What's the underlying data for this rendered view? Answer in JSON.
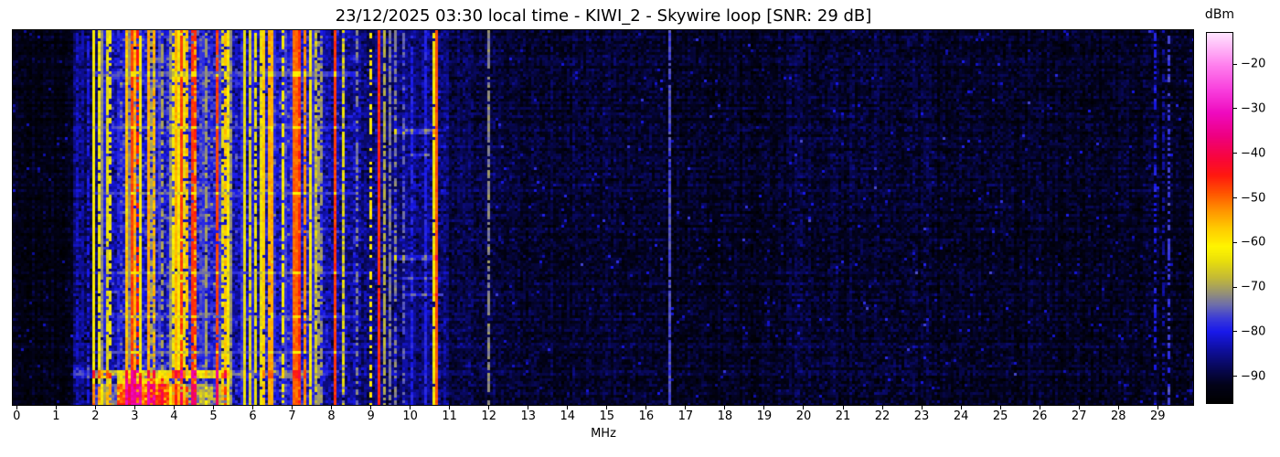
{
  "title": "23/12/2025 03:30 local time - KIWI_2 - Skywire loop [SNR: 29 dB]",
  "chart_data": {
    "type": "heatmap",
    "subtype": "radio-spectrogram-waterfall",
    "xlabel": "MHz",
    "x_range": [
      -0.1,
      29.9
    ],
    "x_ticks": [
      0,
      1,
      2,
      3,
      4,
      5,
      6,
      7,
      8,
      9,
      10,
      11,
      12,
      13,
      14,
      15,
      16,
      17,
      18,
      19,
      20,
      21,
      22,
      23,
      24,
      25,
      26,
      27,
      28,
      29
    ],
    "y_axis": {
      "label": "",
      "ticks": [],
      "meaning": "time, no labels shown"
    },
    "grid": false,
    "legend": false,
    "colorbar": {
      "label": "dBm",
      "ticks": [
        -20,
        -30,
        -40,
        -50,
        -60,
        -70,
        -80,
        -90
      ],
      "range": [
        -96,
        -13
      ],
      "position": "right"
    },
    "colormap_stops": [
      [
        -96,
        "#000000"
      ],
      [
        -92,
        "#020219"
      ],
      [
        -88,
        "#08085a"
      ],
      [
        -84,
        "#0f0fa0"
      ],
      [
        -80,
        "#1919eb"
      ],
      [
        -77,
        "#3c3cd7"
      ],
      [
        -74,
        "#6e6eaa"
      ],
      [
        -71,
        "#9b966e"
      ],
      [
        -68,
        "#c3b937"
      ],
      [
        -64,
        "#ebe10a"
      ],
      [
        -61,
        "#fff500"
      ],
      [
        -57,
        "#ffcd00"
      ],
      [
        -53,
        "#ff9600"
      ],
      [
        -49,
        "#ff5500"
      ],
      [
        -45,
        "#ff190f"
      ],
      [
        -41,
        "#f8053c"
      ],
      [
        -36,
        "#ee0082"
      ],
      [
        -31,
        "#ee0abe"
      ],
      [
        -26,
        "#f83cdc"
      ],
      [
        -20,
        "#ff82ee"
      ],
      [
        -13,
        "#ffe4ff"
      ]
    ],
    "signals": {
      "units": "MHz / dBm",
      "noise_regions": [
        [
          -0.1,
          1.45,
          -92.5,
          2.8
        ],
        [
          1.45,
          2.05,
          -87,
          4.5
        ],
        [
          2.05,
          2.6,
          -84,
          6
        ],
        [
          2.6,
          5.45,
          -80,
          7
        ],
        [
          5.45,
          6.2,
          -83,
          6
        ],
        [
          6.2,
          7.55,
          -81,
          6.5
        ],
        [
          7.55,
          8.75,
          -84,
          5.5
        ],
        [
          8.75,
          9.5,
          -86,
          5
        ],
        [
          9.5,
          10.95,
          -85.5,
          4.5
        ],
        [
          10.95,
          12.15,
          -89,
          4
        ],
        [
          12.15,
          16.5,
          -90.5,
          3.5
        ],
        [
          16.5,
          19.5,
          -91.5,
          3.5
        ],
        [
          19.5,
          23.3,
          -90.5,
          3.8
        ],
        [
          23.3,
          30,
          -91.5,
          3.5
        ]
      ],
      "carriers": [
        {
          "f": 1.55,
          "w": 0.03,
          "level": -82,
          "duty": 0.7
        },
        {
          "f": 1.7,
          "w": 0.03,
          "level": -84,
          "duty": 0.6
        },
        {
          "f": 1.84,
          "w": 0.03,
          "level": -80,
          "duty": 0.65
        },
        {
          "f": 1.97,
          "w": 0.05,
          "level": -61,
          "duty": 1
        },
        {
          "f": 3.08,
          "w": 0.1,
          "level": -45,
          "duty": 0.5
        },
        {
          "f": 6.29,
          "w": 0.07,
          "level": -57,
          "duty": 0.95
        },
        {
          "f": 7.08,
          "w": 0.2,
          "level": -50,
          "duty": 1
        },
        {
          "f": 7.18,
          "w": 0.09,
          "level": -46,
          "duty": 0.85
        },
        {
          "f": 7.3,
          "w": 0.06,
          "level": -52,
          "duty": 0.9
        },
        {
          "f": 8.06,
          "w": 0.04,
          "level": -47,
          "duty": 1
        },
        {
          "f": 8.95,
          "w": 0.05,
          "level": -60,
          "duty": 0.45
        },
        {
          "f": 9.21,
          "w": 0.05,
          "level": -46,
          "duty": 0.95
        },
        {
          "f": 9.33,
          "w": 0.04,
          "level": -69,
          "duty": 0.8
        },
        {
          "f": 9.45,
          "w": 0.03,
          "level": -73,
          "duty": 0.85
        },
        {
          "f": 10.62,
          "w": 0.14,
          "level": -63,
          "duty": 0.9
        },
        {
          "f": 10.66,
          "w": 0.06,
          "level": -49,
          "duty": 1
        },
        {
          "f": 11.96,
          "w": 0.03,
          "level": -72,
          "duty": 0.85
        },
        {
          "f": 16.55,
          "w": 0.03,
          "level": -76,
          "duty": 0.9
        },
        {
          "f": 28.92,
          "w": 0.045,
          "level": -80,
          "duty": 0.5
        },
        {
          "f": 29.1,
          "w": 0.03,
          "level": -84,
          "duty": 0.4
        },
        {
          "f": 29.27,
          "w": 0.05,
          "level": -77,
          "duty": 0.55
        }
      ],
      "stripe_fields": [
        {
          "f0": 2.05,
          "f1": 2.6,
          "count": 7,
          "wmin": 0.025,
          "wmax": 0.05,
          "levels": [
            -79,
            -73,
            -64
          ],
          "weights": [
            0.6,
            0.2,
            0.2
          ],
          "dmin": 0.6,
          "dmax": 1
        },
        {
          "f0": 2.6,
          "f1": 5.45,
          "count": 48,
          "wmin": 0.02,
          "wmax": 0.06,
          "levels": [
            -78,
            -71,
            -63,
            -55,
            -47
          ],
          "weights": [
            0.28,
            0.14,
            0.33,
            0.15,
            0.1
          ],
          "dmin": 0.55,
          "dmax": 1
        },
        {
          "f0": 5.45,
          "f1": 6.2,
          "count": 9,
          "wmin": 0.02,
          "wmax": 0.045,
          "levels": [
            -78,
            -64
          ],
          "weights": [
            0.5,
            0.5
          ],
          "dmin": 0.6,
          "dmax": 1
        },
        {
          "f0": 6.2,
          "f1": 7.55,
          "count": 16,
          "wmin": 0.02,
          "wmax": 0.05,
          "levels": [
            -78,
            -63,
            -55
          ],
          "weights": [
            0.4,
            0.4,
            0.2
          ],
          "dmin": 0.6,
          "dmax": 1
        },
        {
          "f0": 7.55,
          "f1": 8.75,
          "count": 10,
          "wmin": 0.02,
          "wmax": 0.04,
          "levels": [
            -79,
            -72,
            -65
          ],
          "weights": [
            0.45,
            0.25,
            0.3
          ],
          "dmin": 0.5,
          "dmax": 0.9
        },
        {
          "f0": 9.5,
          "f1": 10.9,
          "count": 6,
          "wmin": 0.02,
          "wmax": 0.04,
          "levels": [
            -80,
            -74
          ],
          "weights": [
            0.7,
            0.3
          ],
          "dmin": 0.5,
          "dmax": 0.85
        }
      ],
      "time_events": [
        {
          "t0": 0.9,
          "t1": 0.924,
          "f0": 1.45,
          "f1": 1.95,
          "boost": 6
        },
        {
          "t0": 0.903,
          "t1": 0.924,
          "f0": 1.95,
          "f1": 5.35,
          "boost": 15
        },
        {
          "t0": 0.903,
          "t1": 0.924,
          "f0": 5.35,
          "f1": 7.45,
          "boost": 5
        },
        {
          "t0": 0.924,
          "t1": 1.0,
          "f0": 2.55,
          "f1": 3.9,
          "boost": 22
        },
        {
          "t0": 0.94,
          "t1": 1.0,
          "f0": 1.9,
          "f1": 5.3,
          "boost": 9
        },
        {
          "t0": 0.265,
          "t1": 0.276,
          "f0": 9.6,
          "f1": 10.6,
          "boost": 8
        },
        {
          "t0": 0.33,
          "t1": 0.339,
          "f0": 9.9,
          "f1": 10.5,
          "boost": 7
        },
        {
          "t0": 0.6,
          "t1": 0.615,
          "f0": 9.55,
          "f1": 10.7,
          "boost": 8
        },
        {
          "t0": 0.655,
          "t1": 0.664,
          "f0": 9.7,
          "f1": 10.8,
          "boost": 7
        },
        {
          "t0": 0.7,
          "t1": 0.711,
          "f0": 9.8,
          "f1": 10.85,
          "boost": 7
        }
      ],
      "fade_rows": [
        {
          "t0": 0.112,
          "t1": 0.121,
          "f0": 1.9,
          "f1": 8.7,
          "target": -72,
          "mix": 0.5
        },
        {
          "t0": 0.253,
          "t1": 0.261,
          "f0": 1.9,
          "f1": 8.7,
          "target": -72,
          "mix": 0.45
        },
        {
          "t0": 0.428,
          "t1": 0.437,
          "f0": 1.9,
          "f1": 8.7,
          "target": -72,
          "mix": 0.5
        },
        {
          "t0": 0.522,
          "t1": 0.529,
          "f0": 1.9,
          "f1": 8.7,
          "target": -72,
          "mix": 0.4
        },
        {
          "t0": 0.642,
          "t1": 0.651,
          "f0": 1.9,
          "f1": 8.7,
          "target": -72,
          "mix": 0.45
        },
        {
          "t0": 0.757,
          "t1": 0.764,
          "f0": 1.9,
          "f1": 8.7,
          "target": -72,
          "mix": 0.4
        },
        {
          "t0": 0.852,
          "t1": 0.861,
          "f0": 1.9,
          "f1": 8.7,
          "target": -72,
          "mix": 0.5
        }
      ]
    }
  }
}
